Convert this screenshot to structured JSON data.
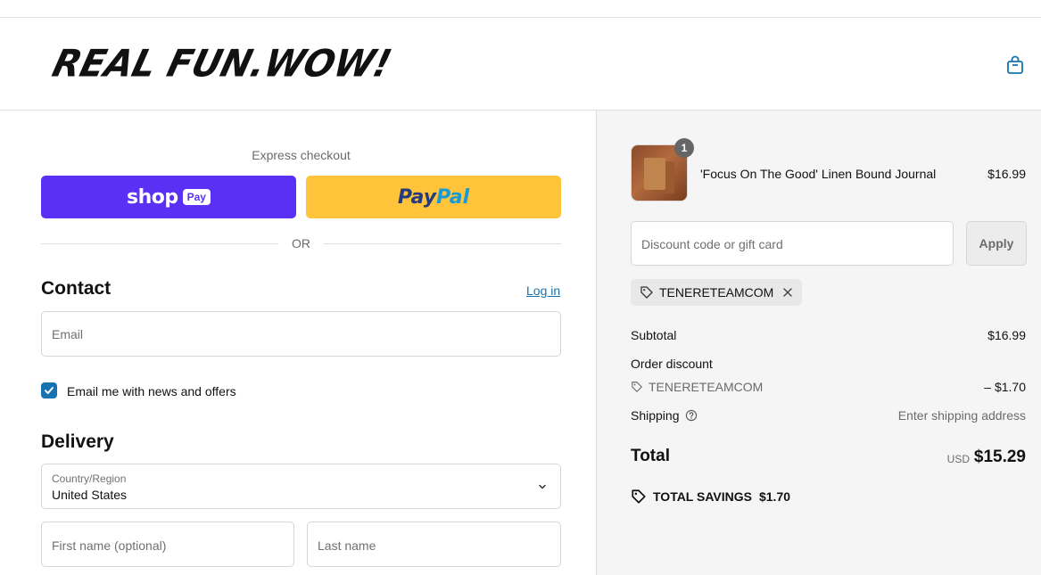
{
  "header": {
    "logo_text": "REAL FUN.WOW!",
    "cart_icon": "shopping-bag-icon"
  },
  "express": {
    "label": "Express checkout",
    "shop_pay": {
      "word": "shop",
      "pay": "Pay"
    },
    "paypal": {
      "part1": "Pay",
      "part2": "Pal"
    },
    "or": "OR"
  },
  "contact": {
    "title": "Contact",
    "login": "Log in",
    "email_placeholder": "Email",
    "newsletter_label": "Email me with news and offers",
    "newsletter_checked": true
  },
  "delivery": {
    "title": "Delivery",
    "country_label": "Country/Region",
    "country_value": "United States",
    "first_name_placeholder": "First name (optional)",
    "last_name_placeholder": "Last name"
  },
  "summary": {
    "item": {
      "name": "'Focus On The Good' Linen Bound Journal",
      "price": "$16.99",
      "quantity": "1"
    },
    "discount_placeholder": "Discount code or gift card",
    "apply": "Apply",
    "applied_code": "TENERETEAMCOM",
    "subtotal_label": "Subtotal",
    "subtotal_value": "$16.99",
    "order_discount_label": "Order discount",
    "discount_code": "TENERETEAMCOM",
    "discount_value": "– $1.70",
    "shipping_label": "Shipping",
    "shipping_value": "Enter shipping address",
    "total_label": "Total",
    "currency": "USD",
    "total_value": "$15.29",
    "savings_label": "TOTAL SAVINGS",
    "savings_value": "$1.70"
  },
  "colors": {
    "shop_pay": "#5a31f4",
    "paypal": "#ffc439",
    "link": "#1773b0",
    "summary_bg": "#f5f5f5"
  }
}
